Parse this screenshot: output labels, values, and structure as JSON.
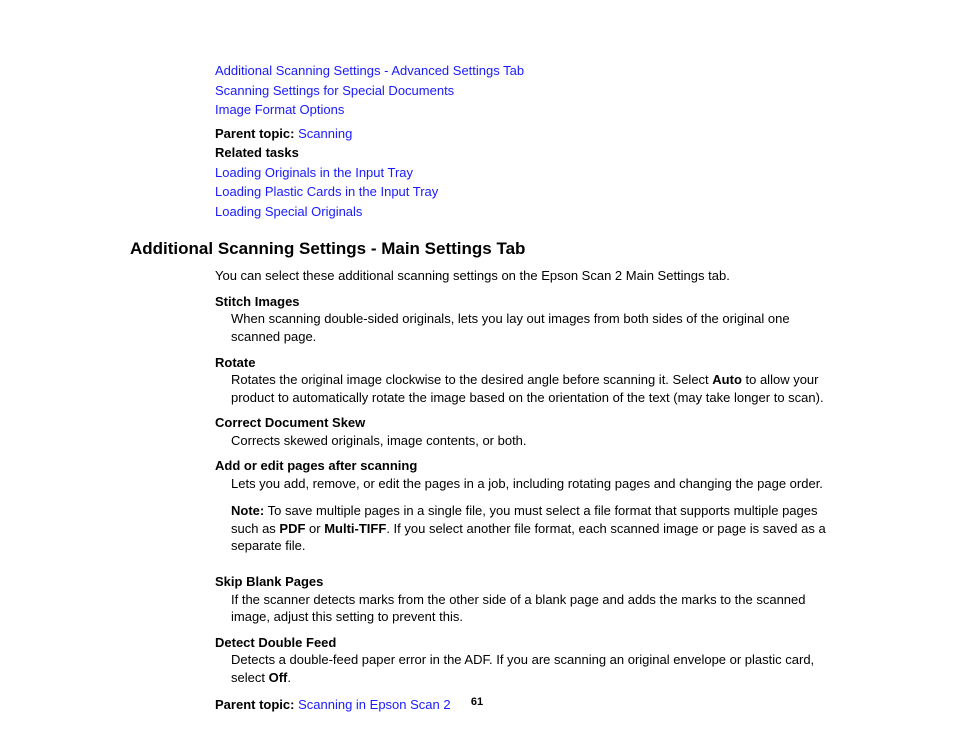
{
  "top_links": [
    "Additional Scanning Settings - Advanced Settings Tab",
    "Scanning Settings for Special Documents",
    "Image Format Options"
  ],
  "parent_topic_label_top": "Parent topic:",
  "parent_topic_link_top": "Scanning",
  "related_tasks_label": "Related tasks",
  "related_tasks_links": [
    "Loading Originals in the Input Tray",
    "Loading Plastic Cards in the Input Tray",
    "Loading Special Originals"
  ],
  "section_title": "Additional Scanning Settings - Main Settings Tab",
  "intro_text": "You can select these additional scanning settings on the Epson Scan 2 Main Settings tab.",
  "defs": {
    "stitch": {
      "term": "Stitch Images",
      "desc": "When scanning double-sided originals, lets you lay out images from both sides of the original one scanned page."
    },
    "rotate": {
      "term": "Rotate",
      "desc_a": "Rotates the original image clockwise to the desired angle before scanning it. Select ",
      "desc_auto": "Auto",
      "desc_b": " to allow your product to automatically rotate the image based on the orientation of the text (may take longer to scan)."
    },
    "skew": {
      "term": "Correct Document Skew",
      "desc": "Corrects skewed originals, image contents, or both."
    },
    "addedit": {
      "term": "Add or edit pages after scanning",
      "desc": "Lets you add, remove, or edit the pages in a job, including rotating pages and changing the page order.",
      "note_label": "Note:",
      "note_a": " To save multiple pages in a single file, you must select a file format that supports multiple pages such as ",
      "note_pdf": "PDF",
      "note_or": " or ",
      "note_mtiff": "Multi-TIFF",
      "note_b": ". If you select another file format, each scanned image or page is saved as a separate file."
    },
    "skip": {
      "term": "Skip Blank Pages",
      "desc": "If the scanner detects marks from the other side of a blank page and adds the marks to the scanned image, adjust this setting to prevent this."
    },
    "ddf": {
      "term": "Detect Double Feed",
      "desc_a": "Detects a double-feed paper error in the ADF. If you are scanning an original envelope or plastic card, select ",
      "desc_off": "Off",
      "desc_b": "."
    }
  },
  "parent_topic_label_bottom": "Parent topic:",
  "parent_topic_link_bottom": "Scanning in Epson Scan 2",
  "page_number": "61"
}
